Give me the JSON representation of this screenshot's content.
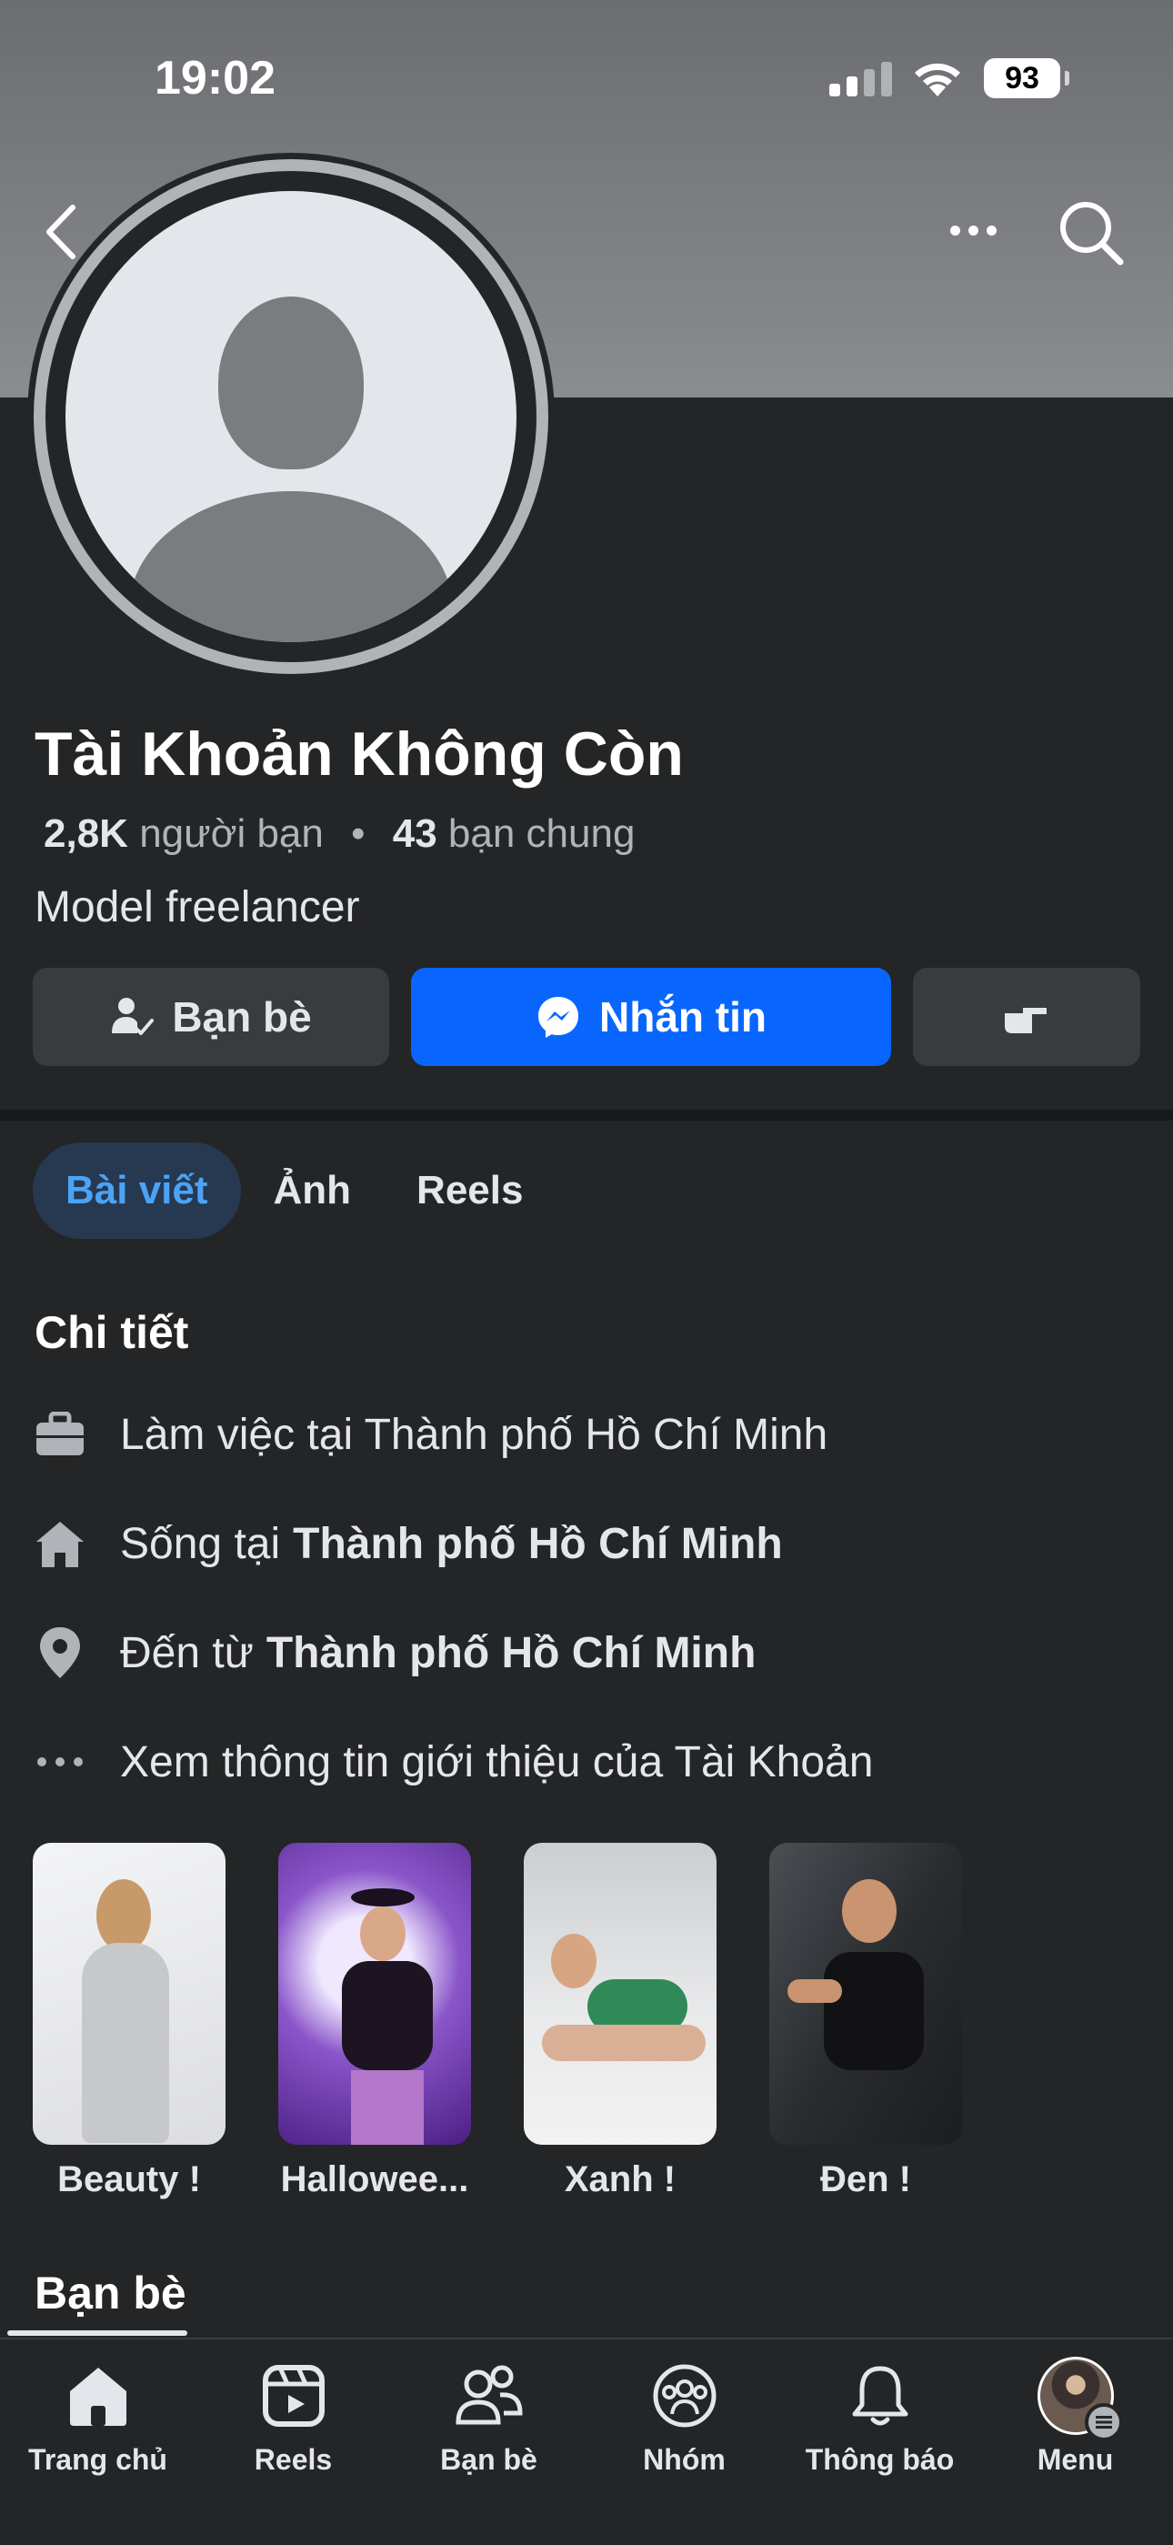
{
  "status_bar": {
    "time": "19:02",
    "battery": "93"
  },
  "profile": {
    "name": "Tài Khoản Không Còn",
    "friends_count": "2,8K",
    "friends_label": "người bạn",
    "separator": "•",
    "mutual_count": "43",
    "mutual_label": "bạn chung",
    "bio": "Model freelancer"
  },
  "actions": {
    "friends_button": "Bạn bè",
    "message_button": "Nhắn tin"
  },
  "tabs": [
    {
      "label": "Bài viết"
    },
    {
      "label": "Ảnh"
    },
    {
      "label": "Reels"
    }
  ],
  "details": {
    "title": "Chi tiết",
    "work": {
      "text": "Làm việc tại Thành phố Hồ Chí Minh"
    },
    "lives": {
      "prefix": "Sống tại",
      "place": "Thành phố Hồ Chí Minh"
    },
    "from": {
      "prefix": "Đến từ",
      "place": "Thành phố Hồ Chí Minh"
    },
    "about": {
      "text": "Xem thông tin giới thiệu của Tài Khoản"
    }
  },
  "featured": [
    {
      "caption": "Beauty !"
    },
    {
      "caption": "Hallowee..."
    },
    {
      "caption": "Xanh !"
    },
    {
      "caption": "Đen !"
    }
  ],
  "friends_section": {
    "title": "Bạn bè"
  },
  "bottom_nav": [
    {
      "label": "Trang chủ",
      "icon": "home-icon"
    },
    {
      "label": "Reels",
      "icon": "reels-icon"
    },
    {
      "label": "Bạn bè",
      "icon": "friends-icon"
    },
    {
      "label": "Nhóm",
      "icon": "groups-icon"
    },
    {
      "label": "Thông báo",
      "icon": "bell-icon"
    },
    {
      "label": "Menu",
      "icon": "menu-avatar"
    }
  ],
  "colors": {
    "accent": "#0866ff",
    "active_tab_bg": "#263951",
    "active_tab_text": "#4ba3f5",
    "background": "#242526"
  }
}
